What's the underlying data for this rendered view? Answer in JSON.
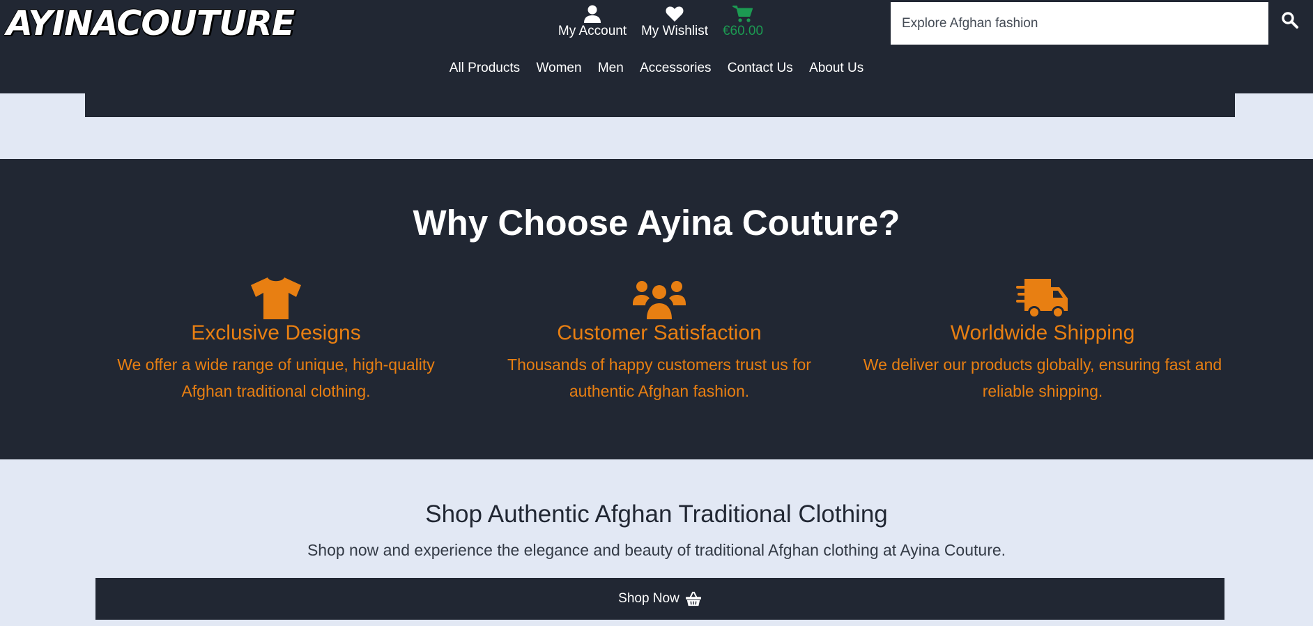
{
  "header": {
    "logo_text": "AYINACOUTURE",
    "account_label": "My Account",
    "wishlist_label": "My Wishlist",
    "cart_amount": "€60.00",
    "search_placeholder": "Explore Afghan fashion",
    "menu": [
      "All Products",
      "Women",
      "Men",
      "Accessories",
      "Contact Us",
      "About Us"
    ],
    "icons": {
      "account": "user-icon",
      "wishlist": "heart-icon",
      "cart": "cart-icon",
      "search": "search-icon"
    }
  },
  "why": {
    "title": "Why Choose Ayina Couture?",
    "features": [
      {
        "icon": "tshirt-icon",
        "title": "Exclusive Designs",
        "text": "We offer a wide range of unique, high-quality Afghan traditional clothing."
      },
      {
        "icon": "users-icon",
        "title": "Customer Satisfaction",
        "text": "Thousands of happy customers trust us for authentic Afghan fashion."
      },
      {
        "icon": "shipping-truck-icon",
        "title": "Worldwide Shipping",
        "text": "We deliver our products globally, ensuring fast and reliable shipping."
      }
    ]
  },
  "cta": {
    "title": "Shop Authentic Afghan Traditional Clothing",
    "subtitle": "Shop now and experience the elegance and beauty of traditional Afghan clothing at Ayina Couture.",
    "button_label": "Shop Now",
    "button_icon": "basket-icon"
  },
  "colors": {
    "dark": "#212733",
    "page_bg": "#e2e8f4",
    "accent_orange": "#e87f12",
    "cart_green": "#1c9a52"
  }
}
